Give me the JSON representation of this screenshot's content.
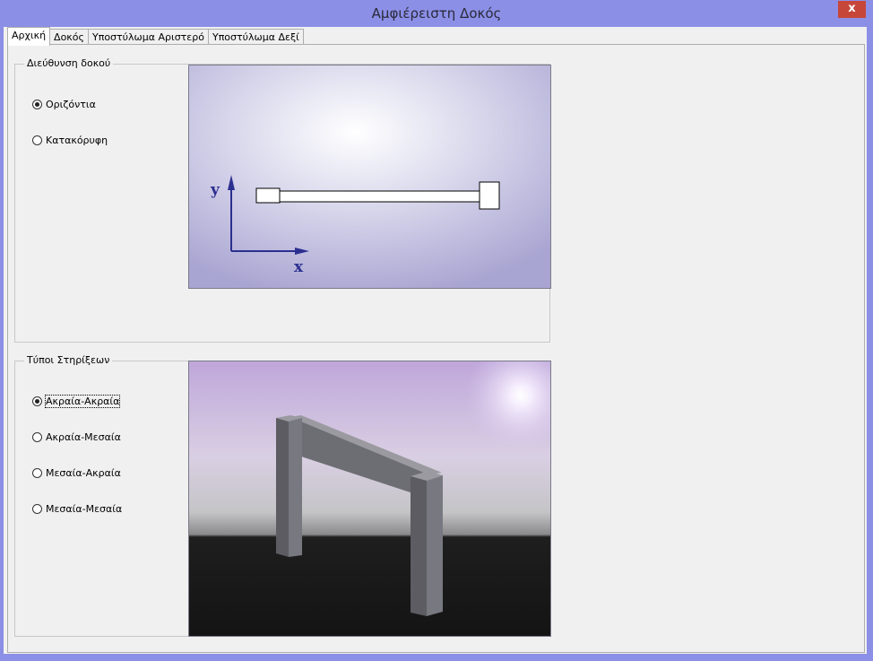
{
  "window": {
    "title": "Αμφιέρειστη Δοκός",
    "close_glyph": "x"
  },
  "tabs": [
    {
      "label": "Αρχική",
      "active": true
    },
    {
      "label": "Δοκός",
      "active": false
    },
    {
      "label": "Υποστύλωμα Αριστερό",
      "active": false
    },
    {
      "label": "Υποστύλωμα Δεξί",
      "active": false
    }
  ],
  "beam_direction": {
    "legend": "Διεύθυνση δοκού",
    "options": [
      {
        "label": "Οριζόντια",
        "selected": true
      },
      {
        "label": "Κατακόρυφη",
        "selected": false
      }
    ],
    "diagram": {
      "x_label": "x",
      "y_label": "y"
    }
  },
  "support_types": {
    "legend": "Τύποι Στηρίξεων",
    "options": [
      {
        "label": "Ακραία-Ακραία",
        "selected": true
      },
      {
        "label": "Ακραία-Μεσαία",
        "selected": false
      },
      {
        "label": "Μεσαία-Ακραία",
        "selected": false
      },
      {
        "label": "Μεσαία-Μεσαία",
        "selected": false
      }
    ]
  },
  "colors": {
    "title_bar": "#8b8fe6",
    "close_button": "#c7463a",
    "axis_color": "#2b2f8f",
    "diagram_bg_edge": "#a9a5d2"
  }
}
